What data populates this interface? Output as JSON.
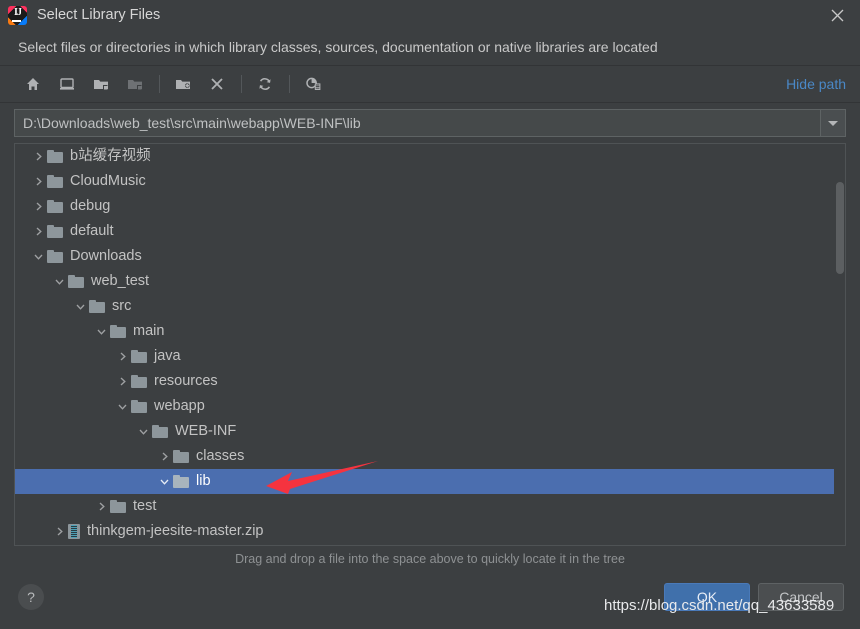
{
  "window": {
    "title": "Select Library Files",
    "app_icon": "intellij-idea-logo",
    "close_icon": "close-icon"
  },
  "subtitle": "Select files or directories in which library classes, sources, documentation or native libraries are located",
  "toolbar": {
    "buttons": [
      {
        "name": "home-icon",
        "label": "Home",
        "disabled": false
      },
      {
        "name": "desktop-icon",
        "label": "Desktop",
        "disabled": false
      },
      {
        "name": "folder-open-icon",
        "label": "Project Directory",
        "disabled": false
      },
      {
        "name": "folder-module-icon",
        "label": "Module Directory",
        "disabled": true
      },
      {
        "name": "new-folder-icon",
        "label": "New Folder",
        "disabled": false
      },
      {
        "name": "delete-icon",
        "label": "Delete",
        "disabled": false
      },
      {
        "name": "refresh-icon",
        "label": "Refresh",
        "disabled": false
      },
      {
        "name": "show-hidden-icon",
        "label": "Show Hidden Files and Directories",
        "disabled": false
      }
    ],
    "hide_path_label": "Hide path"
  },
  "path_field": {
    "value": "D:\\Downloads\\web_test\\src\\main\\webapp\\WEB-INF\\lib",
    "placeholder": "",
    "dropdown_icon": "chevron-down-icon"
  },
  "tree": {
    "rows": [
      {
        "label": "b站缓存视频",
        "depth": 1,
        "state": "collapsed",
        "icon": "folder-icon",
        "selected": false
      },
      {
        "label": "CloudMusic",
        "depth": 1,
        "state": "collapsed",
        "icon": "folder-icon",
        "selected": false
      },
      {
        "label": "debug",
        "depth": 1,
        "state": "collapsed",
        "icon": "folder-icon",
        "selected": false
      },
      {
        "label": "default",
        "depth": 1,
        "state": "collapsed",
        "icon": "folder-icon",
        "selected": false
      },
      {
        "label": "Downloads",
        "depth": 1,
        "state": "expanded",
        "icon": "folder-icon",
        "selected": false
      },
      {
        "label": "web_test",
        "depth": 2,
        "state": "expanded",
        "icon": "folder-icon",
        "selected": false
      },
      {
        "label": "src",
        "depth": 3,
        "state": "expanded",
        "icon": "folder-icon",
        "selected": false
      },
      {
        "label": "main",
        "depth": 4,
        "state": "expanded",
        "icon": "folder-icon",
        "selected": false
      },
      {
        "label": "java",
        "depth": 5,
        "state": "collapsed",
        "icon": "folder-icon",
        "selected": false
      },
      {
        "label": "resources",
        "depth": 5,
        "state": "collapsed",
        "icon": "folder-icon",
        "selected": false
      },
      {
        "label": "webapp",
        "depth": 5,
        "state": "expanded",
        "icon": "folder-icon",
        "selected": false
      },
      {
        "label": "WEB-INF",
        "depth": 6,
        "state": "expanded",
        "icon": "folder-icon",
        "selected": false
      },
      {
        "label": "classes",
        "depth": 7,
        "state": "collapsed",
        "icon": "folder-icon",
        "selected": false
      },
      {
        "label": "lib",
        "depth": 7,
        "state": "expanded",
        "icon": "folder-icon",
        "selected": true
      },
      {
        "label": "test",
        "depth": 4,
        "state": "collapsed",
        "icon": "folder-icon",
        "selected": false
      },
      {
        "label": "thinkgem-jeesite-master.zip",
        "depth": 2,
        "state": "collapsed",
        "icon": "zip-icon",
        "selected": false
      },
      {
        "label": "",
        "depth": 1,
        "state": "collapsed",
        "icon": "folder-icon",
        "selected": false
      }
    ],
    "scrollbar": "vertical-scrollbar"
  },
  "hint": "Drag and drop a file into the space above to quickly locate it in the tree",
  "footer": {
    "help_label": "?",
    "ok_label": "OK",
    "cancel_label": "Cancel"
  },
  "annotation": {
    "arrow_color": "#f5333f",
    "arrow_target": "lib"
  },
  "watermark": "https://blog.csdn.net/qq_43633589",
  "colors": {
    "background": "#3c3f41",
    "selection": "#4b6eaf",
    "link": "#4a88c7",
    "primary_button": "#4070ab",
    "text": "#c3c3c3"
  }
}
